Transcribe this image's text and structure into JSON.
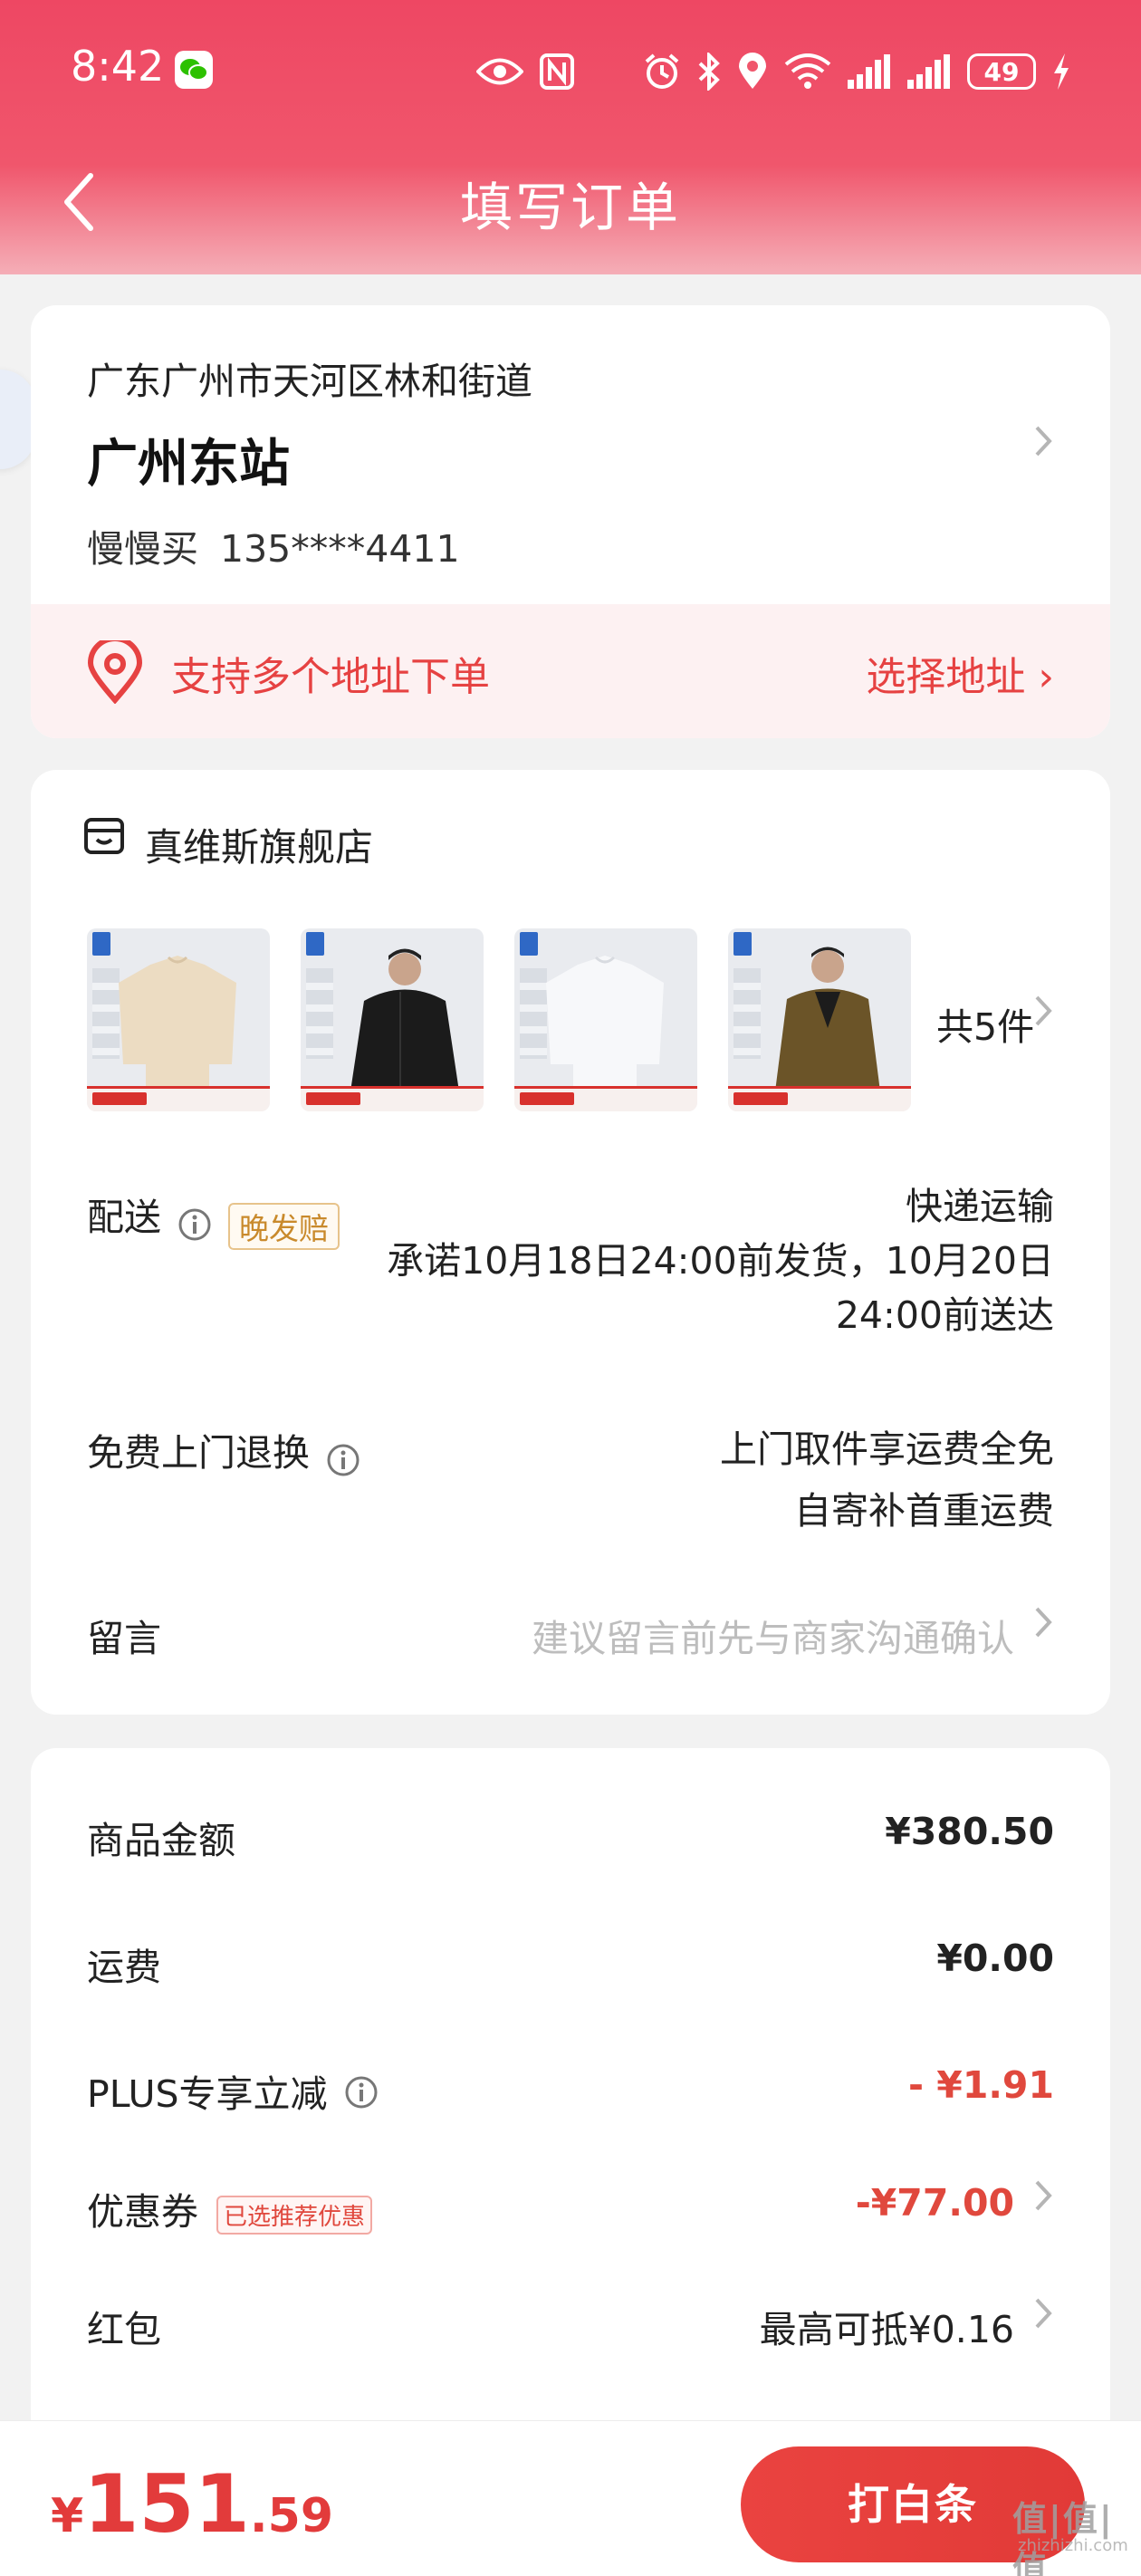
{
  "status_bar": {
    "time": "8:42",
    "battery": "49"
  },
  "nav": {
    "title": "填写订单"
  },
  "address": {
    "region": "广东广州市天河区林和街道",
    "detail": "广州东站",
    "name": "慢慢买",
    "phone": "135****4411",
    "multi_address_text": "支持多个地址下单",
    "choose_address_label": "选择地址 ›"
  },
  "store": {
    "name": "真维斯旗舰店",
    "items_count": "共5件",
    "thumbnails": [
      {
        "alt": "cream-sweater"
      },
      {
        "alt": "black-puffer-jacket"
      },
      {
        "alt": "white-sweater"
      },
      {
        "alt": "olive-puffer-jacket"
      }
    ],
    "delivery": {
      "label": "配送",
      "badge": "晚发赔",
      "method": "快递运输",
      "promise_line1": "承诺10月18日24:00前发货，10月20日",
      "promise_line2": "24:00前送达"
    },
    "return_service": {
      "label": "免费上门退换",
      "line1": "上门取件享运费全免",
      "line2": "自寄补首重运费"
    },
    "message": {
      "label": "留言",
      "placeholder": "建议留言前先与商家沟通确认"
    }
  },
  "price_summary": {
    "goods_amount_label": "商品金额",
    "goods_amount": "¥380.50",
    "shipping_label": "运费",
    "shipping": "¥0.00",
    "plus_label": "PLUS专享立减",
    "plus_discount": "- ¥1.91",
    "coupon_label": "优惠券",
    "coupon_tag": "已选推荐优惠",
    "coupon_discount": "-¥77.00",
    "redpacket_label": "红包",
    "redpacket_value": "最高可抵¥0.16"
  },
  "bottom_bar": {
    "currency": "¥",
    "total_int": "151",
    "total_dec": ".59",
    "pay_button": "打白条"
  },
  "watermark": {
    "text": "值|值|值",
    "sub": "zhizhizhi.com"
  },
  "colors": {
    "brand_red": "#ee4763",
    "price_red": "#e0483d"
  }
}
